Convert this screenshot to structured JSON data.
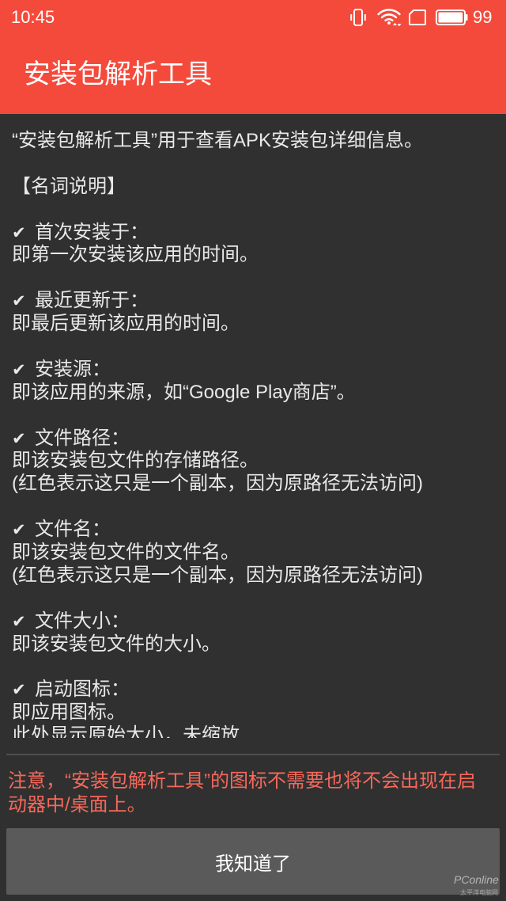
{
  "status_bar": {
    "time": "10:45",
    "battery_level": "99",
    "icons": [
      "vibrate-icon",
      "wifi-icon",
      "sim-card-icon",
      "battery-icon"
    ]
  },
  "app_bar": {
    "title": "安装包解析工具"
  },
  "content": {
    "intro": "“安装包解析工具”用于查看APK安装包详细信息。",
    "section_heading": "【名词说明】",
    "check_icon": "✔",
    "terms": [
      {
        "term": "首次安装于：",
        "lines": [
          "即第一次安装该应用的时间。"
        ]
      },
      {
        "term": "最近更新于：",
        "lines": [
          "即最后更新该应用的时间。"
        ]
      },
      {
        "term": "安装源：",
        "lines": [
          "即该应用的来源，如“Google Play商店”。"
        ]
      },
      {
        "term": "文件路径：",
        "lines": [
          "即该安装包文件的存储路径。",
          "(红色表示这只是一个副本，因为原路径无法访问)"
        ]
      },
      {
        "term": "文件名：",
        "lines": [
          "即该安装包文件的文件名。",
          "(红色表示这只是一个副本，因为原路径无法访问)"
        ]
      },
      {
        "term": "文件大小：",
        "lines": [
          "即该安装包文件的大小。"
        ]
      },
      {
        "term": "启动图标：",
        "lines": [
          "即应用图标。",
          "此处显示原始大小，未缩放"
        ]
      }
    ]
  },
  "notice": "注意，“安装包解析工具”的图标不需要也将不会出现在启动器中/桌面上。",
  "button": {
    "label": "我知道了"
  },
  "watermark": {
    "main": "PConline",
    "sub": "太平洋电脑网"
  },
  "colors": {
    "primary": "#f44a3c",
    "background": "#303030",
    "text": "#e8e8e8",
    "notice": "#f7685a",
    "button": "#5a5a5a",
    "divider": "#4f4f4f"
  }
}
